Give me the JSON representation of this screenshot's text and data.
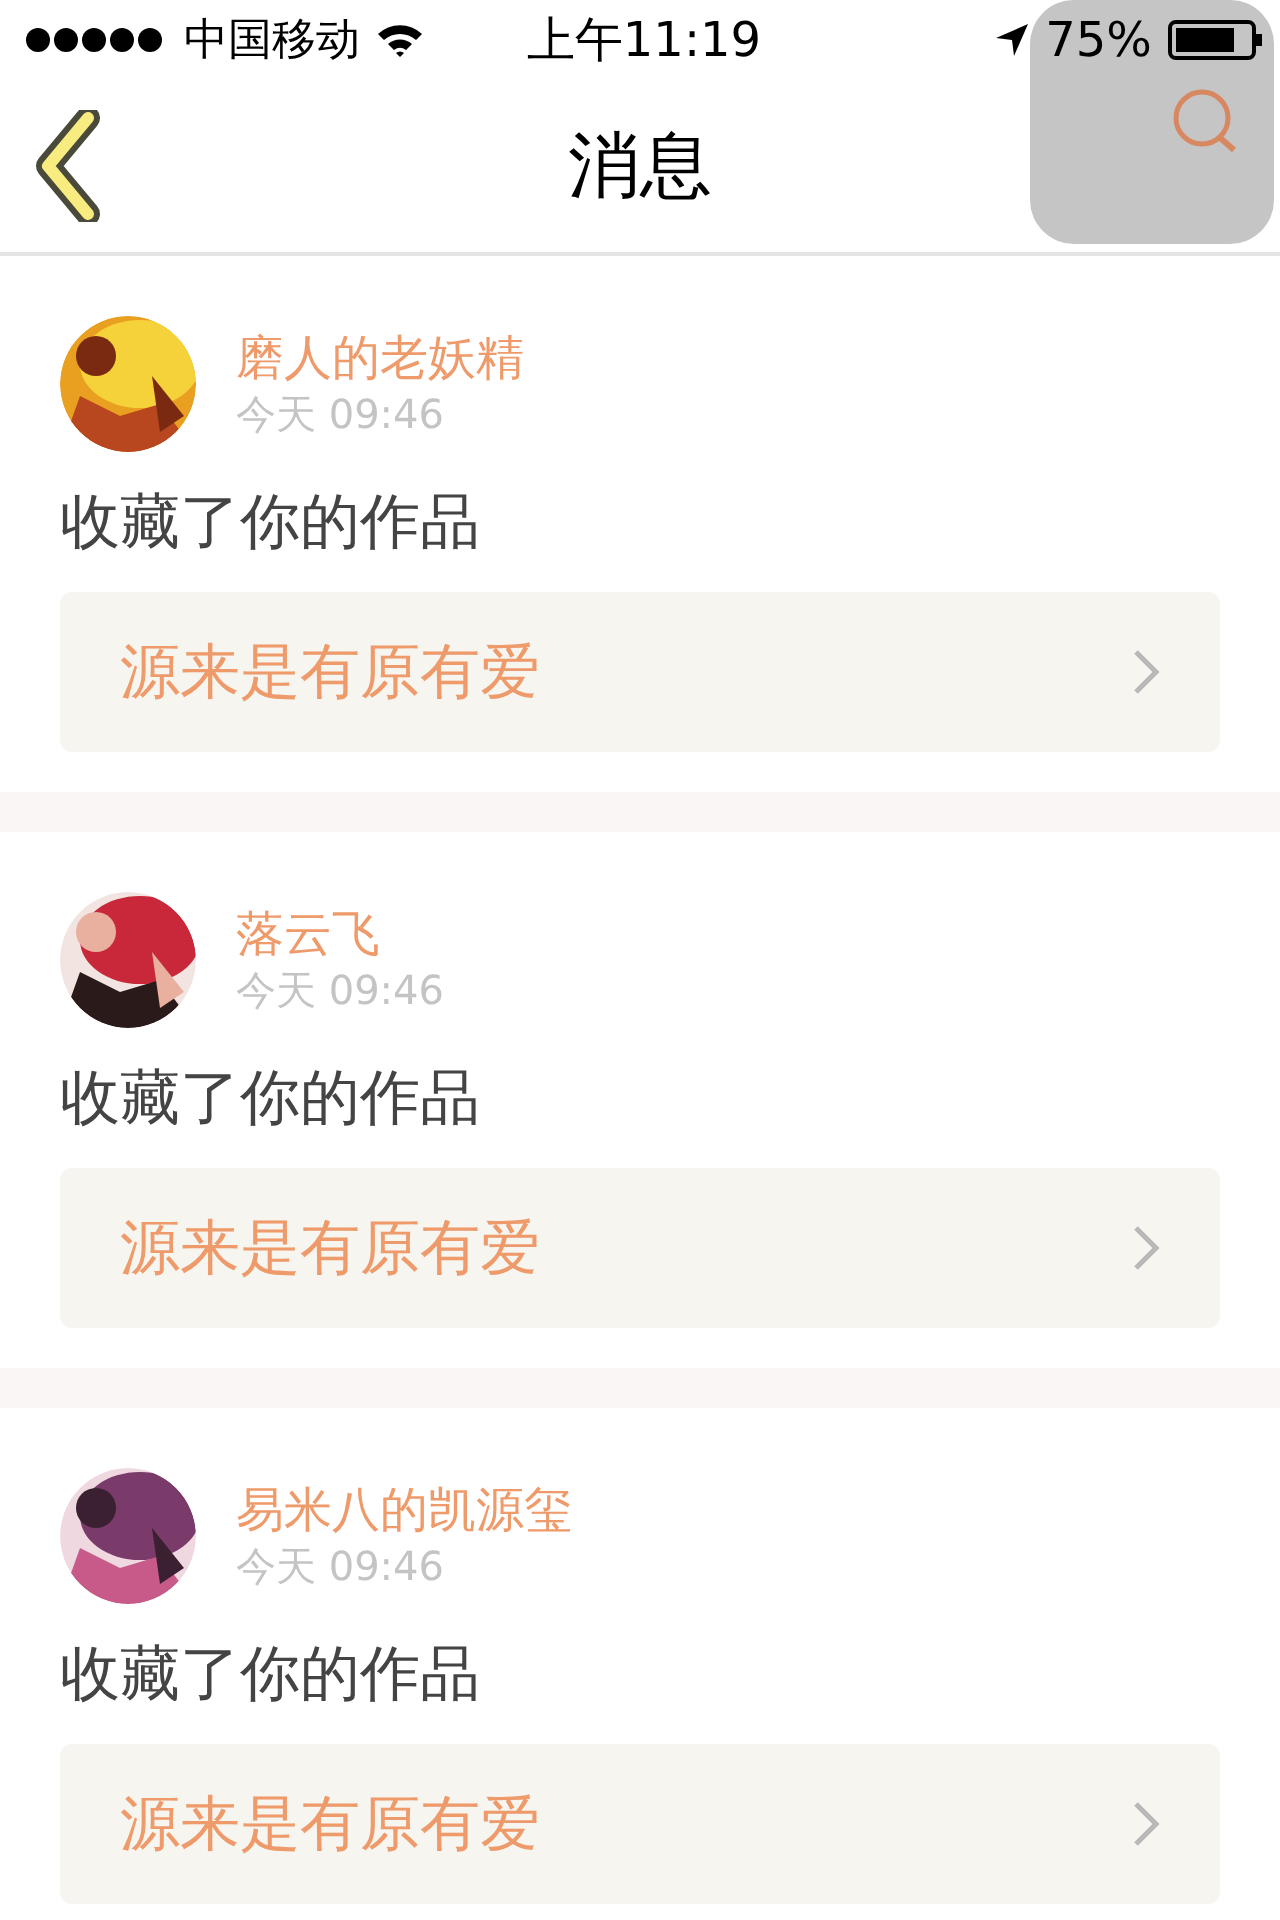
{
  "status_bar": {
    "carrier": "中国移动",
    "time": "上午11:19",
    "battery": "75%"
  },
  "nav": {
    "title": "消息"
  },
  "messages": [
    {
      "user": "磨人的老妖精",
      "time": "今天 09:46",
      "action": "收藏了你的作品",
      "work": "源来是有原有爱"
    },
    {
      "user": "落云飞",
      "time": "今天 09:46",
      "action": "收藏了你的作品",
      "work": "源来是有原有爱"
    },
    {
      "user": "易米八的凯源玺",
      "time": "今天 09:46",
      "action": "收藏了你的作品",
      "work": "源来是有原有爱"
    }
  ]
}
